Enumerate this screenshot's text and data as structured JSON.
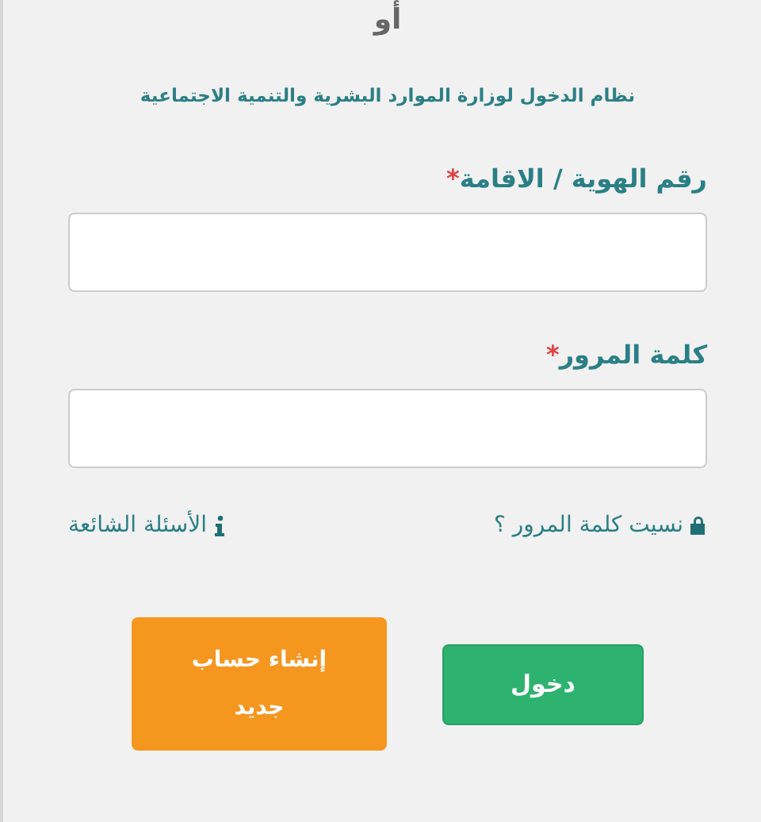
{
  "divider_text": "أو",
  "subtitle": "نظام الدخول لوزارة الموارد البشرية والتنمية الاجتماعية",
  "fields": [
    {
      "label": "رقم الهوية / الاقامة",
      "required_mark": "*"
    },
    {
      "label": "كلمة المرور",
      "required_mark": "*"
    }
  ],
  "links": [
    {
      "label": "نسيت كلمة المرور ؟",
      "kind": "lock"
    },
    {
      "label": "الأسئلة الشائعة",
      "kind": "info"
    }
  ],
  "buttons": [
    {
      "label": "دخول",
      "kind": "login"
    },
    {
      "label": "إنشاء حساب جديد",
      "kind": "register"
    }
  ]
}
